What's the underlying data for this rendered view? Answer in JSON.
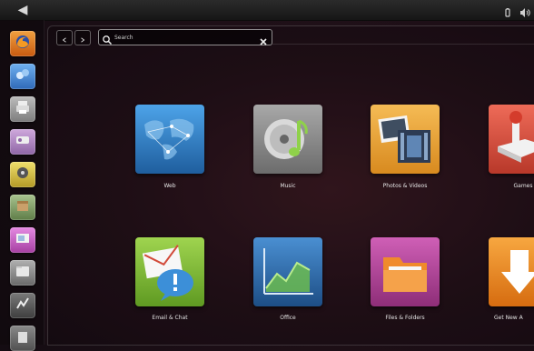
{
  "topbar": {
    "bfb_glyph": "◀",
    "indicators": [
      "battery-icon",
      "volume-icon"
    ]
  },
  "launcher": {
    "items": [
      {
        "icon": "firefox-icon",
        "color": "#e07a1c"
      },
      {
        "icon": "chat-icon",
        "color": "#4d8fd6"
      },
      {
        "icon": "printer-icon",
        "color": "#9a9a9a"
      },
      {
        "icon": "settings-icon",
        "color": "#b38ec4"
      },
      {
        "icon": "music-player-icon",
        "color": "#d8c24a"
      },
      {
        "icon": "package-icon",
        "color": "#6b8c57"
      },
      {
        "icon": "photos-icon",
        "color": "#c562c2"
      },
      {
        "icon": "files-icon",
        "color": "#8a8a8a"
      },
      {
        "icon": "system-monitor-icon",
        "color": "#5c5c5c"
      }
    ]
  },
  "search": {
    "placeholder": "Search"
  },
  "tiles": [
    {
      "id": "web",
      "label": "Web",
      "color": "#2d7fc7"
    },
    {
      "id": "music",
      "label": "Music",
      "color": "#8c8c8c"
    },
    {
      "id": "photos-videos",
      "label": "Photos & Videos",
      "color": "#e8a33b"
    },
    {
      "id": "games",
      "label": "Games",
      "color": "#d64a3a"
    },
    {
      "id": "email-chat",
      "label": "Email & Chat",
      "color": "#7ebc3a"
    },
    {
      "id": "office",
      "label": "Office",
      "color": "#2c6aa8"
    },
    {
      "id": "files-folders",
      "label": "Files & Folders",
      "color": "#b94a9e"
    },
    {
      "id": "get-new-apps",
      "label": "Get New A",
      "color": "#f08a1c"
    }
  ]
}
